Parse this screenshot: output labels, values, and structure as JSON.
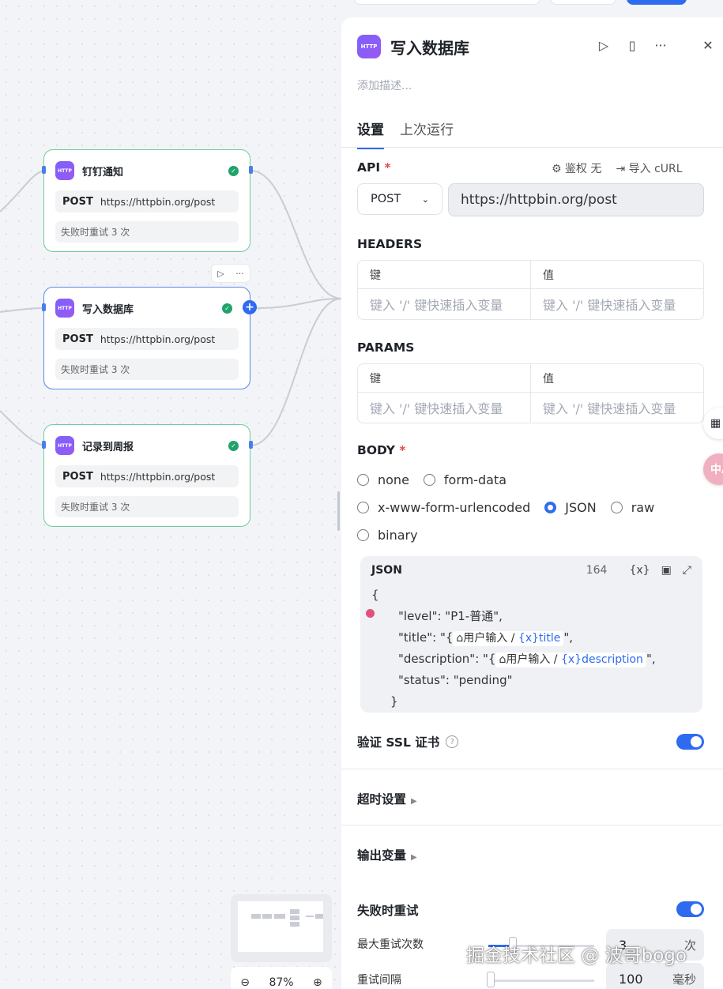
{
  "canvas": {
    "nodes": [
      {
        "title": "钉钉通知",
        "method": "POST",
        "url": "https://httpbin.org/post",
        "retry": "失败时重试 3 次",
        "badge": "HTTP"
      },
      {
        "title": "写入数据库",
        "method": "POST",
        "url": "https://httpbin.org/post",
        "retry": "失败时重试 3 次",
        "badge": "HTTP"
      },
      {
        "title": "记录到周报",
        "method": "POST",
        "url": "https://httpbin.org/post",
        "retry": "失败时重试 3 次",
        "badge": "HTTP"
      }
    ],
    "node_tools": {
      "run": "▷",
      "more": "···"
    },
    "zoom": "87%"
  },
  "panel": {
    "badge": "HTTP",
    "title": "写入数据库",
    "description_placeholder": "添加描述...",
    "tabs": [
      "设置",
      "上次运行"
    ],
    "api": {
      "label": "API",
      "required": "*",
      "auth": "鉴权 无",
      "import": "导入 cURL",
      "method": "POST",
      "url": "https://httpbin.org/post"
    },
    "headers": {
      "label": "HEADERS",
      "key_header": "键",
      "value_header": "值",
      "key_placeholder": "键入 '/' 键快速插入变量",
      "value_placeholder": "键入 '/' 键快速插入变量"
    },
    "params": {
      "label": "PARAMS",
      "key_header": "键",
      "value_header": "值",
      "key_placeholder": "键入 '/' 键快速插入变量",
      "value_placeholder": "键入 '/' 键快速插入变量"
    },
    "body": {
      "label": "BODY",
      "required": "*",
      "options": [
        "none",
        "form-data",
        "x-www-form-urlencoded",
        "JSON",
        "raw",
        "binary"
      ],
      "selected": "JSON"
    },
    "json": {
      "label": "JSON",
      "count": "164",
      "open_brace": "{",
      "line_level": "\"level\": \"P1-普通\",",
      "line_title_prefix": "\"title\": \"{",
      "line_title_suffix": "\",",
      "line_desc_prefix": "\"description\": \"{",
      "line_desc_suffix": "\",",
      "chip_source": "用户输入",
      "var_title": "title",
      "var_description": "description",
      "line_status": "\"status\": \"pending\"",
      "close_brace": "}"
    },
    "ssl": {
      "label": "验证 SSL 证书",
      "enabled": true
    },
    "timeout": {
      "label": "超时设置"
    },
    "output": {
      "label": "输出变量"
    },
    "retry": {
      "label": "失败时重试",
      "enabled": true,
      "max_label": "最大重试次数",
      "max_value": "3",
      "max_unit": "次",
      "interval_label": "重试间隔",
      "interval_value": "100",
      "interval_unit": "毫秒"
    }
  },
  "floating": {
    "lang": "中A"
  },
  "watermark": "掘金技术社区 @ 波哥bogo",
  "colors": {
    "accent": "#2f6bf0",
    "success_border": "#6fcc99",
    "badge": "#7b61ff",
    "error": "#e5484d"
  }
}
